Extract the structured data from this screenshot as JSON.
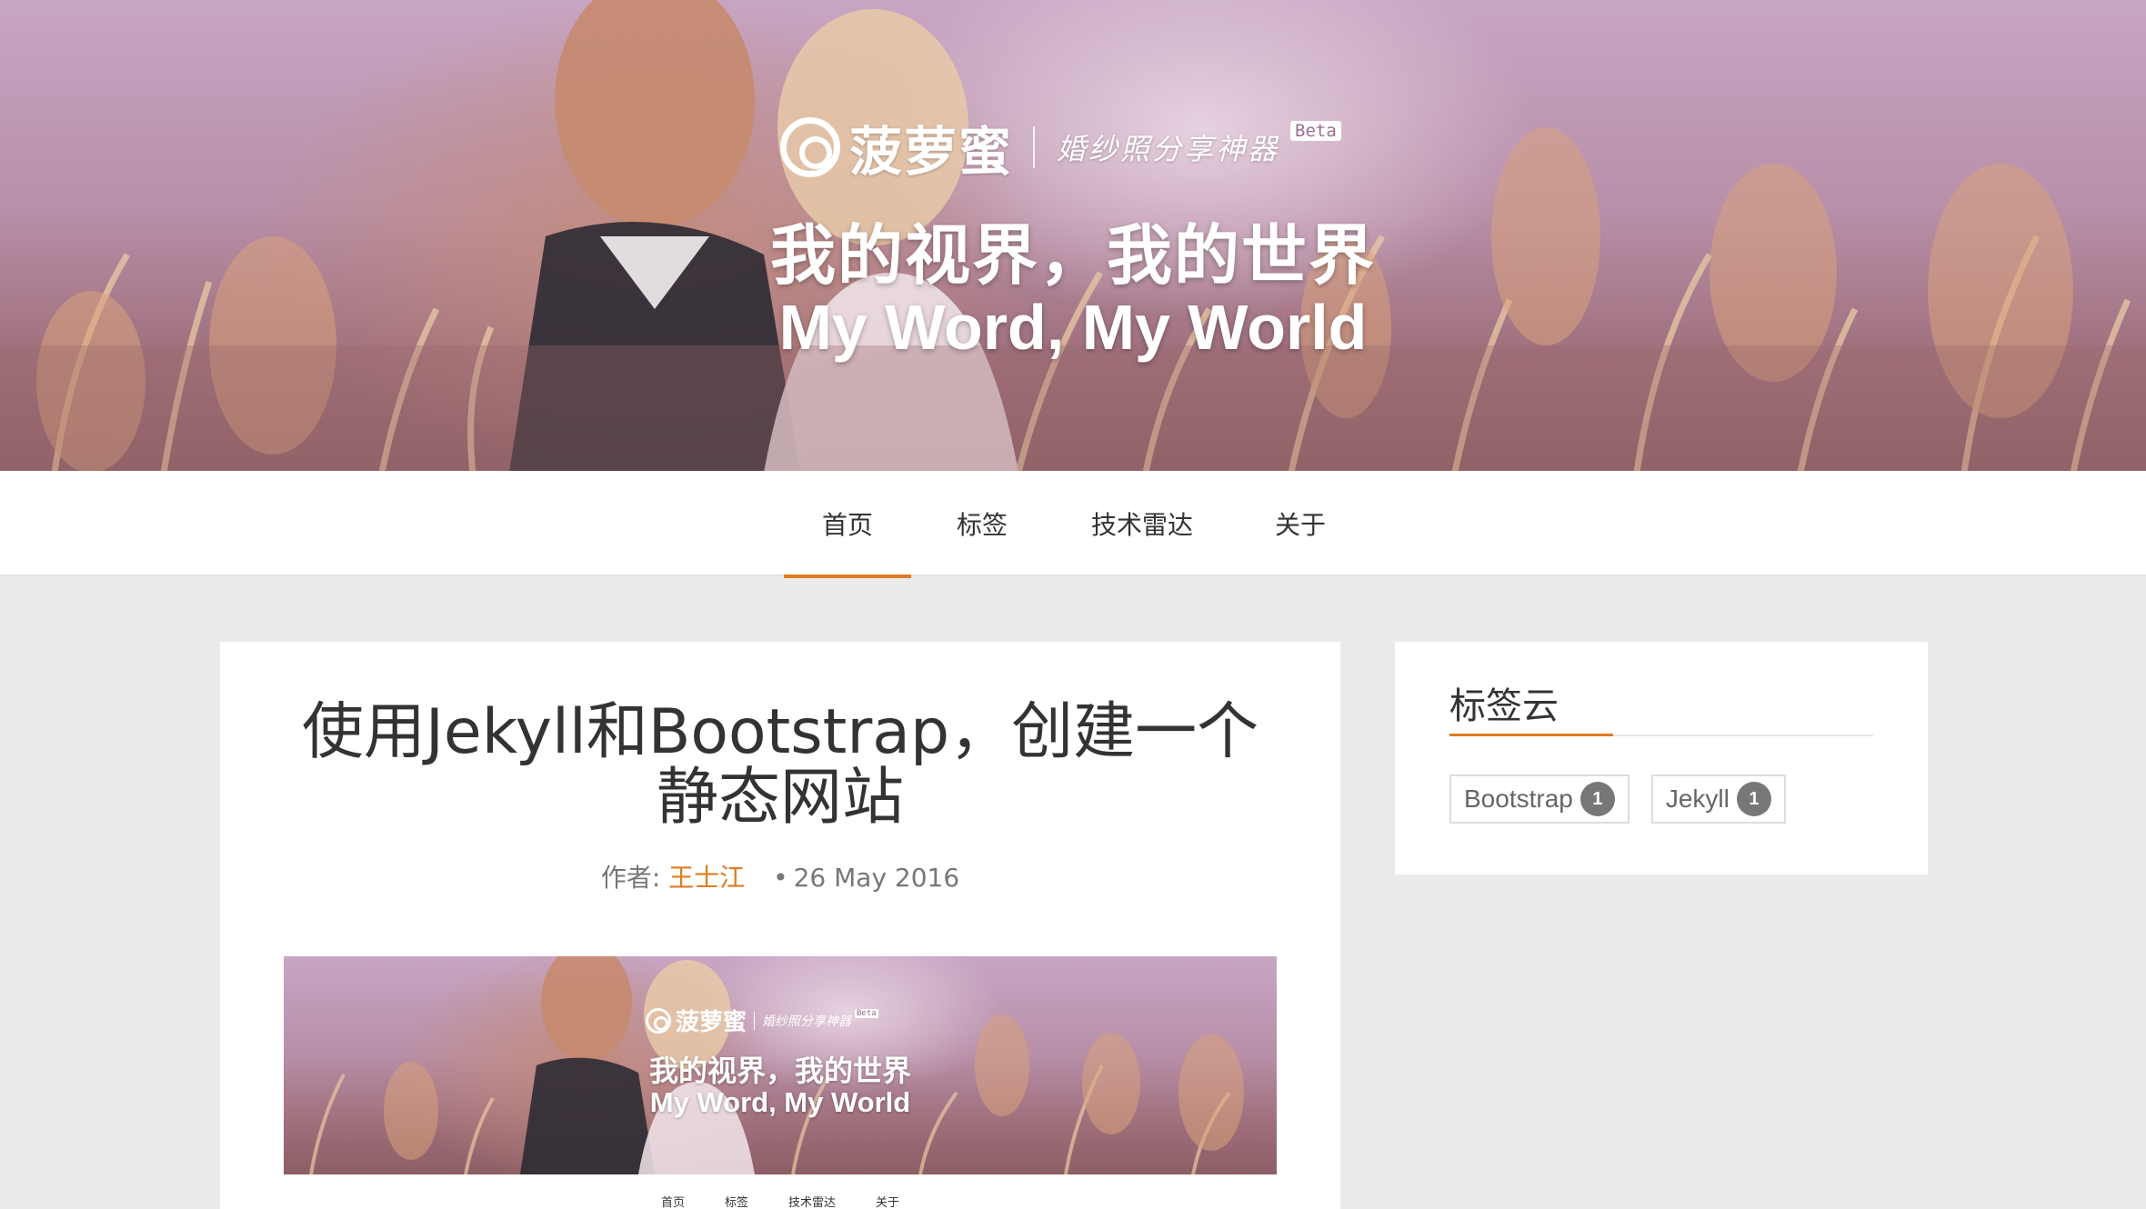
{
  "hero": {
    "brand_name": "菠萝蜜",
    "brand_slogan": "婚纱照分享神器",
    "beta": "Beta",
    "title_cn": "我的视界，我的世界",
    "title_en": "My Word, My World"
  },
  "nav": {
    "items": [
      {
        "label": "首页",
        "active": true
      },
      {
        "label": "标签"
      },
      {
        "label": "技术雷达"
      },
      {
        "label": "关于"
      }
    ]
  },
  "post": {
    "title_line1": "使用Jekyll和Bootstrap，创建一个",
    "title_line2": "静态网站",
    "meta_prefix": "作者:",
    "author": "王士江",
    "date": "26 May 2016",
    "image": {
      "brand_name": "菠萝蜜",
      "brand_slogan": "婚纱照分享神器",
      "beta": "Beta",
      "title_cn": "我的视界，我的世界",
      "title_en": "My Word, My World",
      "nav": [
        "首页",
        "标签",
        "技术雷达",
        "关于"
      ]
    }
  },
  "sidebar": {
    "title": "标签云",
    "tags": [
      {
        "name": "Bootstrap",
        "count": "1"
      },
      {
        "name": "Jekyll",
        "count": "1"
      }
    ]
  },
  "colors": {
    "accent": "#e07b1f",
    "background": "#ebebeb",
    "card": "#ffffff"
  }
}
